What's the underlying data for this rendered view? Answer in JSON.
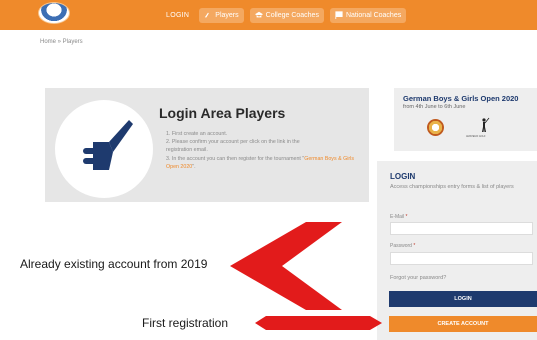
{
  "nav": {
    "login": "LOGIN",
    "players": "Players",
    "college_coaches": "College Coaches",
    "national_coaches": "National Coaches"
  },
  "breadcrumb": "Home » Players",
  "login_area": {
    "title": "Login Area Players",
    "steps": [
      "1. First create an account.",
      "2. Please confirm your account per click on the link in the",
      "registration email.",
      "3. In the account you can then register for the tournament \"",
      "German Boys & Girls Open 2020",
      "\"."
    ]
  },
  "tournament": {
    "title": "German Boys & Girls Open 2020",
    "dates": "from 4th June to 6th June"
  },
  "login_panel": {
    "title": "LOGIN",
    "description": "Access championships entry forms & list of players",
    "email_label": "E-Mail",
    "password_label": "Password",
    "forgot_link": "Forgot your password?",
    "login_button": "LOGIN",
    "create_button": "CREATE ACCOUNT"
  },
  "annotations": {
    "existing": "Already existing account from 2019",
    "first": "First registration"
  },
  "colors": {
    "brand_orange": "#ef8a2b",
    "brand_navy": "#1e3a6e",
    "annotation_red": "#e21b1b"
  },
  "icons": [
    "golf-club-icon",
    "player-icon",
    "graduation-cap-icon",
    "flag-icon"
  ]
}
